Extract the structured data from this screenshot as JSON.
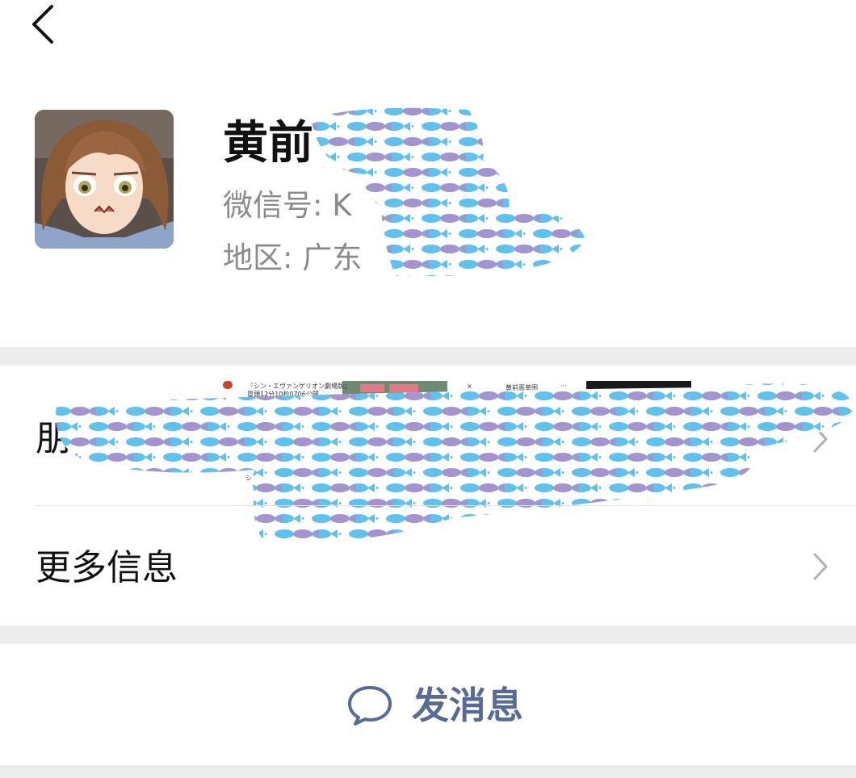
{
  "header": {
    "back_icon": "chevron-left-icon"
  },
  "profile": {
    "nickname": "黄前",
    "wechat_id": "微信号: K",
    "region": "地区: 广东"
  },
  "rows": [
    {
      "label": "朋",
      "icon": "chevron-right-icon"
    },
    {
      "label": "更多信息",
      "icon": "chevron-right-icon"
    }
  ],
  "thumbnail_text": {
    "a": "『シン・エヴァンゲリオン劇場版』",
    "b": "冒頭12分10秒0706公開",
    "c": "黄前面单图",
    "d": "シン・エヴァ",
    "close": "×",
    "more": "···"
  },
  "actions": {
    "send_message_label": "发消息",
    "send_message_icon": "chat-bubble-icon"
  },
  "colors": {
    "link": "#576b95",
    "secondary_text": "#8a8a8a",
    "fish_blue": "#5fc1ee",
    "fish_purple": "#a394cf"
  }
}
